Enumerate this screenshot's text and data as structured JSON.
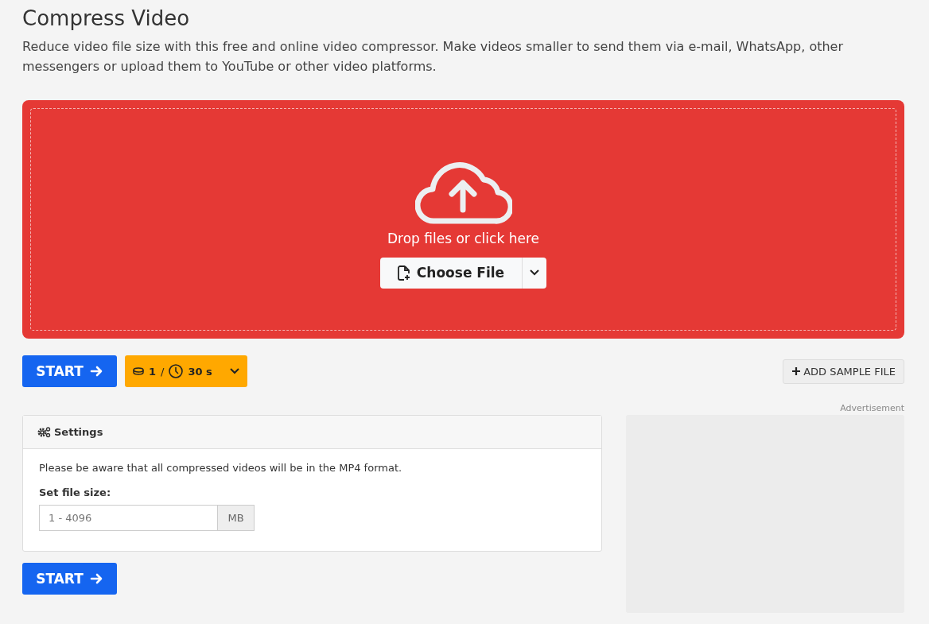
{
  "page": {
    "title": "Compress Video",
    "description": "Reduce video file size with this free and online video compressor. Make videos smaller to send them via e-mail, WhatsApp, other messengers or upload them to YouTube or other video platforms."
  },
  "dropzone": {
    "prompt": "Drop files or click here",
    "choose_button": "Choose File"
  },
  "actions": {
    "start": "START",
    "credits": "1",
    "separator": "/",
    "time": "30 s",
    "add_sample": "ADD SAMPLE FILE"
  },
  "settings": {
    "title": "Settings",
    "note": "Please be aware that all compressed videos will be in the MP4 format.",
    "field_label": "Set file size:",
    "placeholder": "1 - 4096",
    "unit": "MB"
  },
  "bottom_start": "START",
  "ad": {
    "label": "Advertisement"
  }
}
